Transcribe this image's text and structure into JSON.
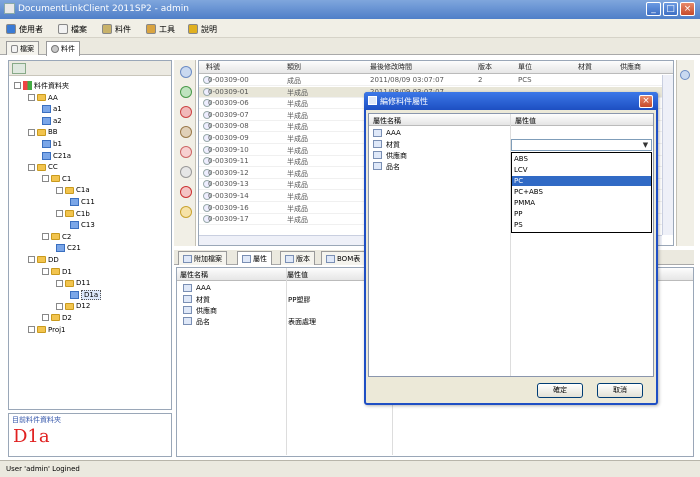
{
  "window": {
    "title": "DocumentLinkClient 2011SP2 - admin"
  },
  "menu": [
    {
      "label": "使用者",
      "icon": "user-icon",
      "color": "#3a7bd5"
    },
    {
      "label": "檔案",
      "icon": "file-icon",
      "color": "#f2f2f2"
    },
    {
      "label": "料件",
      "icon": "part-icon",
      "color": "#c8b26a"
    },
    {
      "label": "工具",
      "icon": "tools-icon",
      "color": "#d9a441"
    },
    {
      "label": "說明",
      "icon": "help-icon",
      "color": "#e0b020"
    }
  ],
  "tabs": [
    {
      "label": "檔案",
      "active": false
    },
    {
      "label": "料件",
      "active": true
    }
  ],
  "tree": {
    "root": "料件資料夾",
    "nodes": [
      {
        "label": "AA",
        "level": 1,
        "type": "folder"
      },
      {
        "label": "a1",
        "level": 2,
        "type": "doc"
      },
      {
        "label": "a2",
        "level": 2,
        "type": "doc"
      },
      {
        "label": "BB",
        "level": 1,
        "type": "folder"
      },
      {
        "label": "b1",
        "level": 2,
        "type": "doc"
      },
      {
        "label": "C21a",
        "level": 2,
        "type": "doc"
      },
      {
        "label": "CC",
        "level": 1,
        "type": "folder"
      },
      {
        "label": "C1",
        "level": 2,
        "type": "folder"
      },
      {
        "label": "C1a",
        "level": 3,
        "type": "folder"
      },
      {
        "label": "C11",
        "level": 4,
        "type": "doc"
      },
      {
        "label": "C1b",
        "level": 3,
        "type": "folder"
      },
      {
        "label": "C13",
        "level": 4,
        "type": "doc"
      },
      {
        "label": "C2",
        "level": 2,
        "type": "folder"
      },
      {
        "label": "C21",
        "level": 3,
        "type": "doc"
      },
      {
        "label": "DD",
        "level": 1,
        "type": "folder"
      },
      {
        "label": "D1",
        "level": 2,
        "type": "folder"
      },
      {
        "label": "D11",
        "level": 3,
        "type": "folder"
      },
      {
        "label": "D1a",
        "level": 4,
        "type": "doc",
        "selected": true
      },
      {
        "label": "D12",
        "level": 3,
        "type": "folder"
      },
      {
        "label": "D2",
        "level": 2,
        "type": "folder"
      },
      {
        "label": "Proj1",
        "level": 1,
        "type": "folder"
      }
    ]
  },
  "selected_folder": {
    "caption": "目前料件資料夾",
    "value": "D1a"
  },
  "grid": {
    "columns": [
      "料號",
      "類別",
      "最後修改時間",
      "版本",
      "單位",
      "材質",
      "供應商"
    ],
    "rows": [
      [
        "0-00309-00",
        "成品",
        "2011/08/09 03:07:07",
        "2",
        "PCS",
        "",
        ""
      ],
      [
        "0-00309-01",
        "半成品",
        "2011/08/09 03:07:07",
        "",
        "",
        "",
        ""
      ],
      [
        "0-00309-06",
        "半成品",
        "",
        "",
        "",
        "",
        ""
      ],
      [
        "0-00309-07",
        "半成品",
        "",
        "",
        "",
        "",
        ""
      ],
      [
        "0-00309-08",
        "半成品",
        "",
        "",
        "",
        "",
        ""
      ],
      [
        "0-00309-09",
        "半成品",
        "",
        "",
        "",
        "",
        ""
      ],
      [
        "0-00309-10",
        "半成品",
        "",
        "",
        "",
        "",
        ""
      ],
      [
        "0-00309-11",
        "半成品",
        "",
        "",
        "",
        "",
        ""
      ],
      [
        "0-00309-12",
        "半成品",
        "",
        "",
        "",
        "",
        ""
      ],
      [
        "0-00309-13",
        "半成品",
        "",
        "",
        "",
        "",
        ""
      ],
      [
        "0-00309-14",
        "半成品",
        "",
        "",
        "",
        "",
        ""
      ],
      [
        "0-00309-16",
        "半成品",
        "",
        "",
        "",
        "",
        ""
      ],
      [
        "0-00309-17",
        "半成品",
        "",
        "",
        "",
        "",
        ""
      ]
    ]
  },
  "bottom_tabs": [
    {
      "label": "附加檔案",
      "active": false
    },
    {
      "label": "屬性",
      "active": true
    },
    {
      "label": "版本",
      "active": false
    },
    {
      "label": "BOM表",
      "active": false
    }
  ],
  "properties": {
    "columns": [
      "屬性名稱",
      "屬性值"
    ],
    "rows": [
      {
        "name": "AAA",
        "value": ""
      },
      {
        "name": "材質",
        "value": "PP塑膠"
      },
      {
        "name": "供應商",
        "value": ""
      },
      {
        "name": "品名",
        "value": "表面處理"
      }
    ]
  },
  "dialog": {
    "title": "編修料件屬性",
    "columns": [
      "屬性名稱",
      "屬性值"
    ],
    "rows": [
      {
        "name": "AAA",
        "value": ""
      },
      {
        "name": "材質",
        "value": ""
      },
      {
        "name": "供應商",
        "value": ""
      },
      {
        "name": "品名",
        "value": ""
      }
    ],
    "options": [
      "ABS",
      "LCV",
      "PC",
      "PC+ABS",
      "PMMA",
      "PP",
      "PS"
    ],
    "selected_option": "PC",
    "ok_label": "確定",
    "cancel_label": "取消"
  },
  "status": {
    "text": "User 'admin' Logined"
  },
  "colors": {
    "title_bar": "#4f7fc8",
    "selection": "#316ac5",
    "selected_folder_text": "#e02020"
  }
}
